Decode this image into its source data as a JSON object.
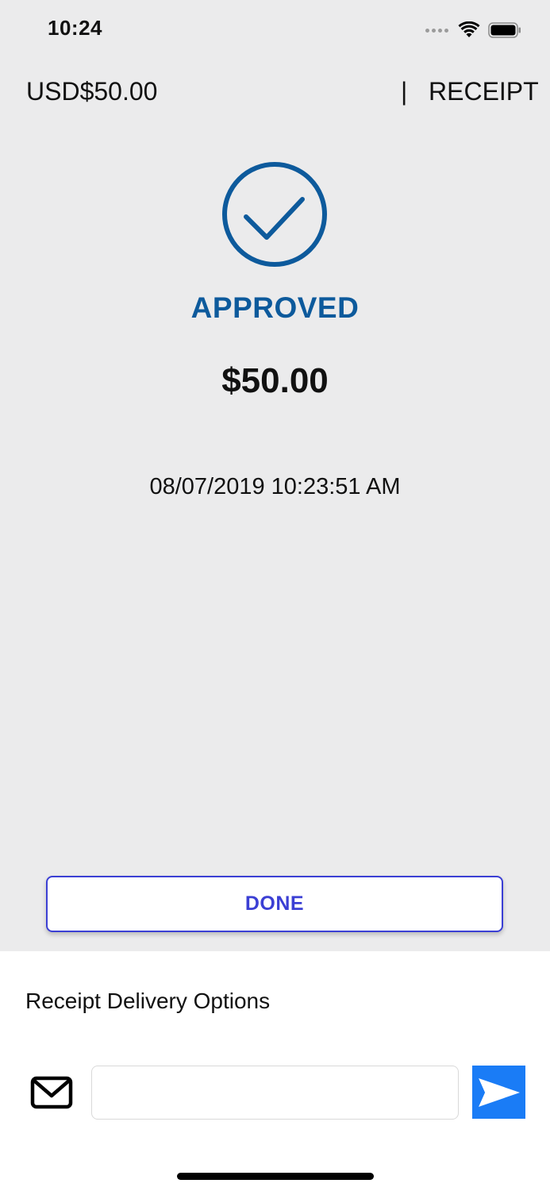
{
  "status_bar": {
    "time": "10:24",
    "icons": [
      "cellular-dots-icon",
      "wifi-icon",
      "battery-icon"
    ]
  },
  "header": {
    "amount": "USD$50.00",
    "divider": "|",
    "receipt_label": "RECEIPT"
  },
  "result": {
    "icon": "checkmark-circle-icon",
    "status": "APPROVED",
    "amount": "$50.00",
    "datetime": "08/07/2019 10:23:51 AM"
  },
  "actions": {
    "done_label": "DONE"
  },
  "delivery": {
    "title": "Receipt Delivery Options",
    "email_value": "",
    "email_placeholder": "",
    "mail_icon": "mail-icon",
    "send_icon": "send-icon"
  },
  "colors": {
    "approved_blue": "#0d5a9c",
    "done_button_accent": "#3b3fd4",
    "send_button_blue": "#1a7cf6",
    "top_background": "#ebebec",
    "bottom_background": "#ffffff"
  }
}
